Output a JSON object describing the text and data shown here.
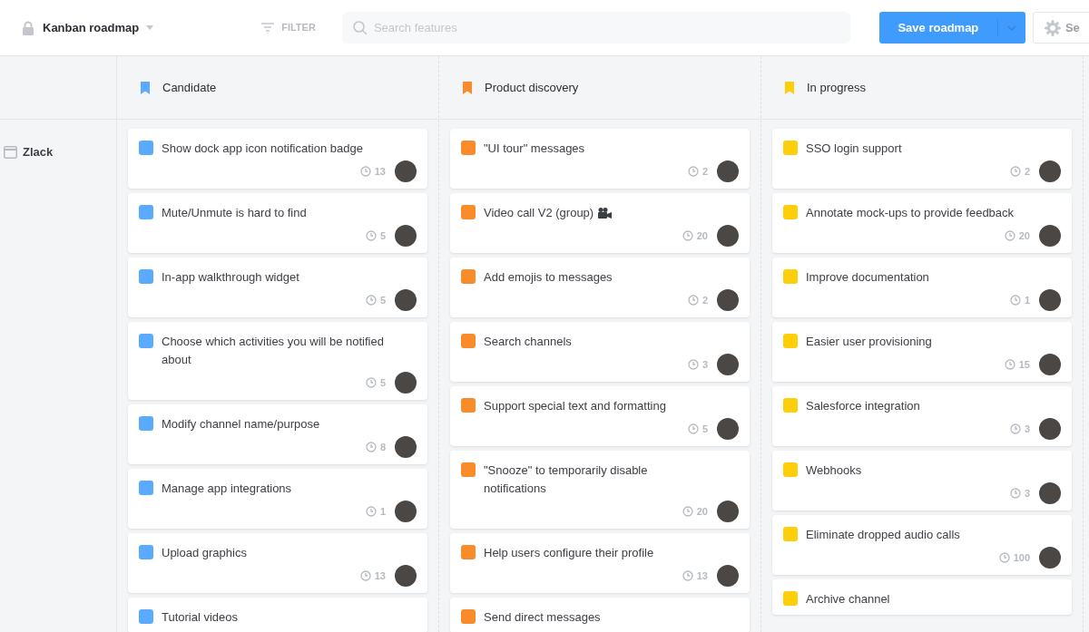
{
  "header": {
    "title": "Kanban roadmap",
    "filter_label": "FILTER",
    "search": {
      "placeholder": "Search features"
    },
    "save_button": "Save roadmap",
    "settings_button": "Se"
  },
  "swimlane": {
    "label": "Zlack"
  },
  "columns": [
    {
      "title": "Candidate",
      "color": "#5aabff",
      "cards": [
        {
          "title": "Show dock app icon notification badge",
          "count": "13"
        },
        {
          "title": "Mute/Unmute is hard to find",
          "count": "5"
        },
        {
          "title": "In-app walkthrough widget",
          "count": "5"
        },
        {
          "title": "Choose which activities you will be notified about",
          "count": "5"
        },
        {
          "title": "Modify channel name/purpose",
          "count": "8"
        },
        {
          "title": "Manage app integrations",
          "count": "1"
        },
        {
          "title": "Upload graphics",
          "count": "13"
        },
        {
          "title": "Tutorial videos"
        }
      ]
    },
    {
      "title": "Product discovery",
      "color": "#fa8b2a",
      "cards": [
        {
          "title": "\"UI tour\" messages",
          "count": "2"
        },
        {
          "title": "Video call V2 (group)",
          "count": "20",
          "kind": "camera"
        },
        {
          "title": "Add emojis to messages",
          "count": "2"
        },
        {
          "title": "Search channels",
          "count": "3"
        },
        {
          "title": "Support special text and formatting",
          "count": "5"
        },
        {
          "title": "\"Snooze\" to temporarily disable notifications",
          "count": "20"
        },
        {
          "title": "Help users configure their profile",
          "count": "13"
        },
        {
          "title": "Send direct messages"
        }
      ]
    },
    {
      "title": "In progress",
      "color": "#fccf0a",
      "cards": [
        {
          "title": "SSO login support",
          "count": "2"
        },
        {
          "title": "Annotate mock-ups to provide feedback",
          "count": "20"
        },
        {
          "title": "Improve documentation",
          "count": "1"
        },
        {
          "title": "Easier user provisioning",
          "count": "15"
        },
        {
          "title": "Salesforce integration",
          "count": "3"
        },
        {
          "title": "Webhooks",
          "count": "3"
        },
        {
          "title": "Eliminate dropped audio calls",
          "count": "100"
        },
        {
          "title": "Archive channel"
        }
      ]
    }
  ]
}
